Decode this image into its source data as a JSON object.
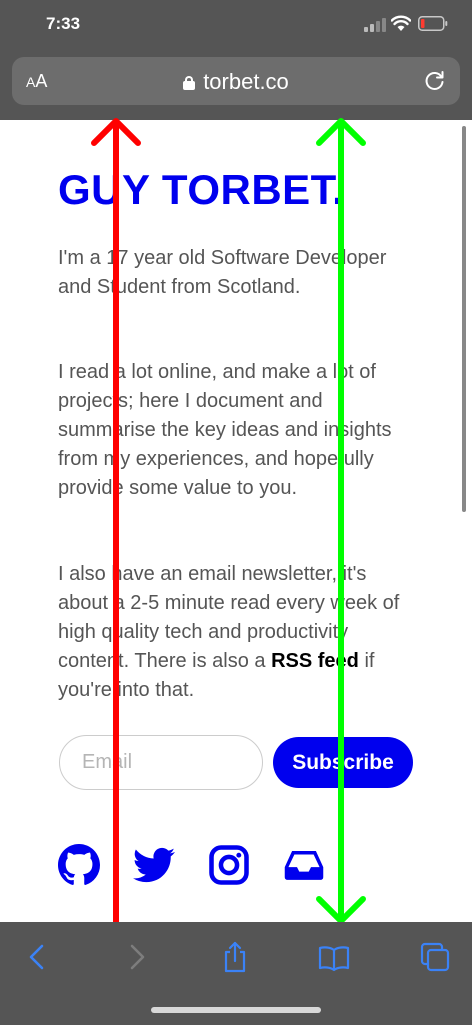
{
  "status_bar": {
    "time": "7:33"
  },
  "url_bar": {
    "text_size_label_small": "A",
    "text_size_label_large": "A",
    "domain": "torbet.co"
  },
  "page": {
    "title": "GUY TORBET.",
    "intro": "I'm a 17 year old Software Developer and Student from Scotland.",
    "about": "I read a lot online, and make a lot of projects; here I document and summarise the key ideas and insights from my experiences, and hopefully provide some value to you.",
    "newsletter_before": "I also have an email newsletter, it's about a 2-5 minute read every week of high quality tech and productivity content. There is also a ",
    "rss_link": "RSS feed",
    "newsletter_after": " if you're into that.",
    "email_placeholder": "Email",
    "subscribe_label": "Subscribe",
    "social_icons": [
      "github-icon",
      "twitter-icon",
      "instagram-icon",
      "inbox-icon"
    ]
  },
  "toolbar": {
    "icons": [
      "back-icon",
      "forward-icon",
      "share-icon",
      "bookmarks-icon",
      "tabs-icon"
    ]
  },
  "colors": {
    "accent": "#0000ee",
    "chrome": "#555555",
    "toolbar_icon": "#3b82f6",
    "annotation_red": "#ff0000",
    "annotation_green": "#00ff00"
  }
}
